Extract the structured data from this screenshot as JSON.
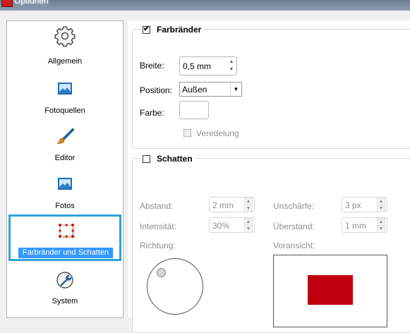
{
  "window": {
    "title": "Optionen"
  },
  "colors": {
    "selection": "#3399ff",
    "selection_border": "#2fa3d8",
    "preview_red": "#c00010",
    "icon_blue": "#1f6fb5"
  },
  "sidebar": {
    "items": [
      {
        "label": "Allgemein",
        "icon": "gear-icon"
      },
      {
        "label": "Fotoquellen",
        "icon": "image-icon"
      },
      {
        "label": "Editor",
        "icon": "brush-icon"
      },
      {
        "label": "Fotos",
        "icon": "image-icon"
      },
      {
        "label": "Farbränder und Schatten",
        "icon": "frame-shadow-icon",
        "selected": true
      },
      {
        "label": "System",
        "icon": "wrench-icon"
      }
    ]
  },
  "borders": {
    "title": "Farbränder",
    "checked": true,
    "width_label": "Breite:",
    "width_value": "0,5 mm",
    "position_label": "Position:",
    "position_value": "Außen",
    "color_label": "Farbe:",
    "color_value": "#ffffff",
    "refine_label": "Veredelung",
    "refine_checked": false
  },
  "shadow": {
    "title": "Schatten",
    "checked": false,
    "distance_label": "Abstand:",
    "distance_value": "2 mm",
    "intensity_label": "Intensität:",
    "intensity_value": "30%",
    "blur_label": "Unschärfe:",
    "blur_value": "3 px",
    "overhang_label": "Überstand:",
    "overhang_value": "1 mm",
    "direction_label": "Richtung:",
    "preview_label": "Voransicht:"
  }
}
